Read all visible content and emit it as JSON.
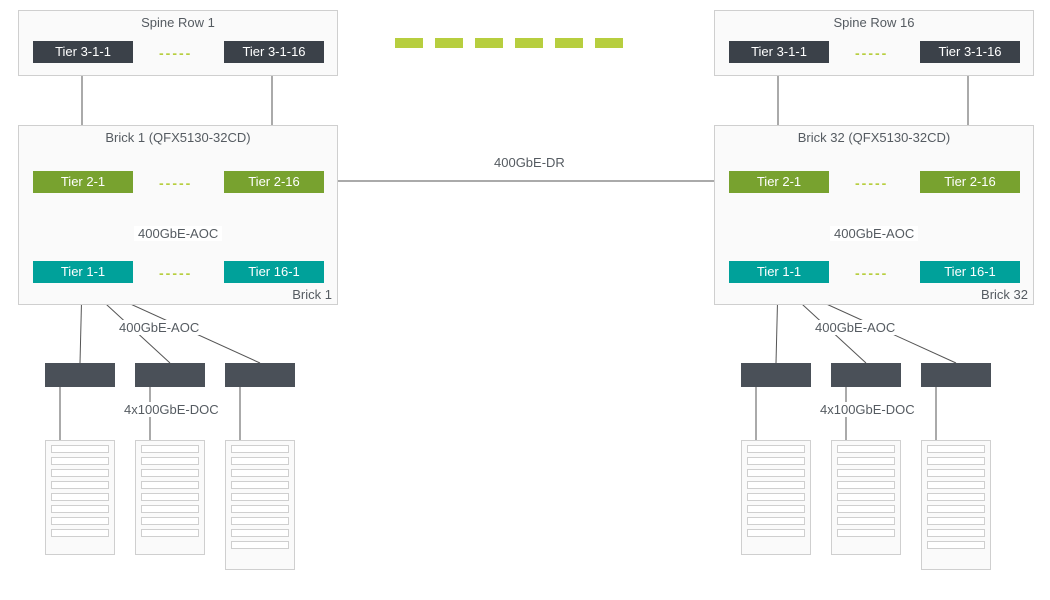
{
  "spine_left": {
    "title": "Spine Row 1",
    "node_a": "Tier 3-1-1",
    "node_b": "Tier 3-1-16"
  },
  "spine_right": {
    "title": "Spine Row 16",
    "node_a": "Tier 3-1-1",
    "node_b": "Tier 3-1-16"
  },
  "brick_left": {
    "title": "Brick 1 (QFX5130-32CD)",
    "t2a": "Tier 2-1",
    "t2b": "Tier 2-16",
    "midlabel": "400GbE-AOC",
    "t1a": "Tier 1-1",
    "t1b": "Tier 16-1",
    "corner": "Brick 1"
  },
  "brick_right": {
    "title": "Brick 32 (QFX5130-32CD)",
    "t2a": "Tier 2-1",
    "t2b": "Tier 2-16",
    "midlabel": "400GbE-AOC",
    "t1a": "Tier 1-1",
    "t1b": "Tier 16-1",
    "corner": "Brick 32"
  },
  "link_dr": "400GbE-DR",
  "rack_left": {
    "aoc": "400GbE-AOC",
    "doc": "4x100GbE-DOC"
  },
  "rack_right": {
    "aoc": "400GbE-AOC",
    "doc": "4x100GbE-DOC"
  }
}
